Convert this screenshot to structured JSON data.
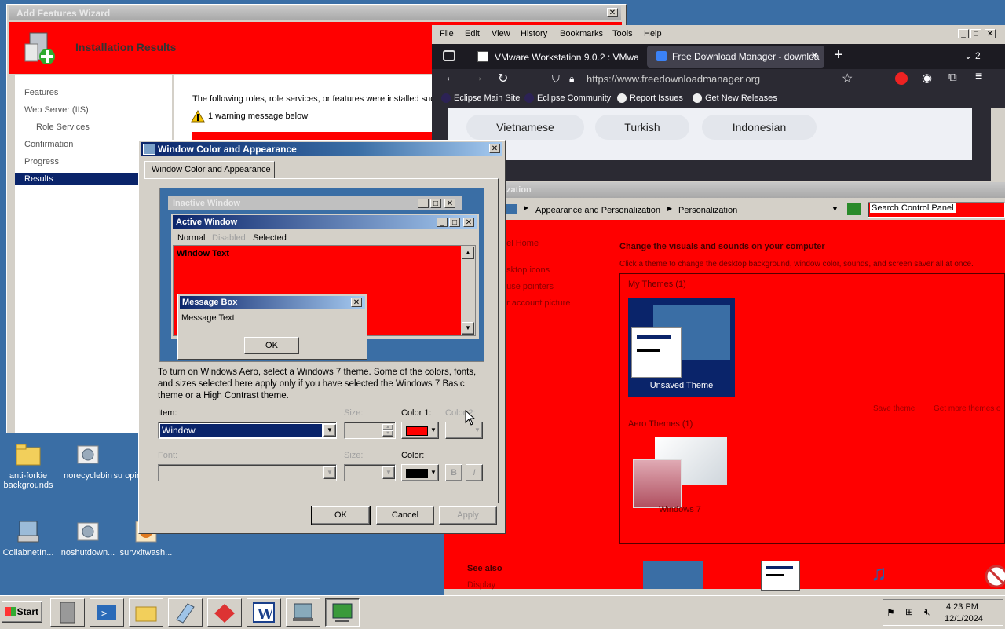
{
  "wizard": {
    "title": "Add Features Wizard",
    "close": "✕",
    "banner_title": "Installation Results",
    "steps": [
      "Features",
      "Web Server (IIS)",
      "Role Services",
      "Confirmation",
      "Progress",
      "Results"
    ],
    "intro": "The following roles, role services, or features were installed suc",
    "warning": "1 warning message below"
  },
  "firefox": {
    "menu": [
      "File",
      "Edit",
      "View",
      "History",
      "Bookmarks",
      "Tools",
      "Help"
    ],
    "tabs": [
      "VMware Workstation 9.0.2 : VMwa",
      "Free Download Manager - downloa"
    ],
    "tab_count": "2",
    "url": "https://www.freedownloadmanager.org",
    "bookmarks": [
      "Eclipse Main Site",
      "Eclipse Community",
      "Report Issues",
      "Get New Releases"
    ],
    "languages": [
      "Vietnamese",
      "Turkish",
      "Indonesian"
    ]
  },
  "control_panel": {
    "title_fragment": "zation",
    "breadcrumb": [
      "Appearance and Personalization",
      "Personalization"
    ],
    "search_placeholder": "Search Control Panel",
    "side_links": [
      "nel Home",
      "esktop icons",
      "ouse pointers",
      "ur account picture"
    ],
    "heading": "Change the visuals and sounds on your computer",
    "subheading": "Click a theme to change the desktop background, window color, sounds, and screen saver all at once.",
    "my_themes": "My Themes (1)",
    "unsaved_theme": "Unsaved Theme",
    "save_theme": "Save theme",
    "get_more": "Get more themes o",
    "aero_themes": "Aero Themes (1)",
    "windows7": "Windows 7",
    "see_also": "See also",
    "display": "Display"
  },
  "dialog": {
    "title": "Window Color and Appearance",
    "tab": "Window Color and Appearance",
    "preview": {
      "inactive": "Inactive Window",
      "active": "Active Window",
      "menu_normal": "Normal",
      "menu_disabled": "Disabled",
      "menu_selected": "Selected",
      "window_text": "Window Text",
      "msgbox_title": "Message Box",
      "msgbox_text": "Message Text",
      "msgbox_ok": "OK"
    },
    "description": "To turn on Windows Aero, select a Windows 7 theme.  Some of the colors, fonts, and sizes selected here apply only if you have selected the Windows 7 Basic theme or a High Contrast theme.",
    "item_label": "Item:",
    "item_value": "Window",
    "size_label": "Size:",
    "color1_label": "Color 1:",
    "color2_label": "Color 2:",
    "font_label": "Font:",
    "size2_label": "Size:",
    "color_label": "Color:",
    "bold": "B",
    "italic": "I",
    "ok": "OK",
    "cancel": "Cancel",
    "apply": "Apply",
    "color1_swatch": "#ff0000",
    "color_swatch": "#000000"
  },
  "desktop_icons": [
    {
      "label": "anti-forkie backgrounds"
    },
    {
      "label": "norecyclebin"
    },
    {
      "label": "su opin"
    },
    {
      "label": "CollabnetIn..."
    },
    {
      "label": "noshutdown..."
    },
    {
      "label": "survxltwash..."
    }
  ],
  "taskbar": {
    "start": "Start",
    "time": "4:23 PM",
    "date": "12/1/2024"
  },
  "colors": {
    "accent_red": "#ff0000",
    "desktop": "#3a6ea5",
    "classic_face": "#d4d0c8",
    "selection": "#0a246a"
  }
}
